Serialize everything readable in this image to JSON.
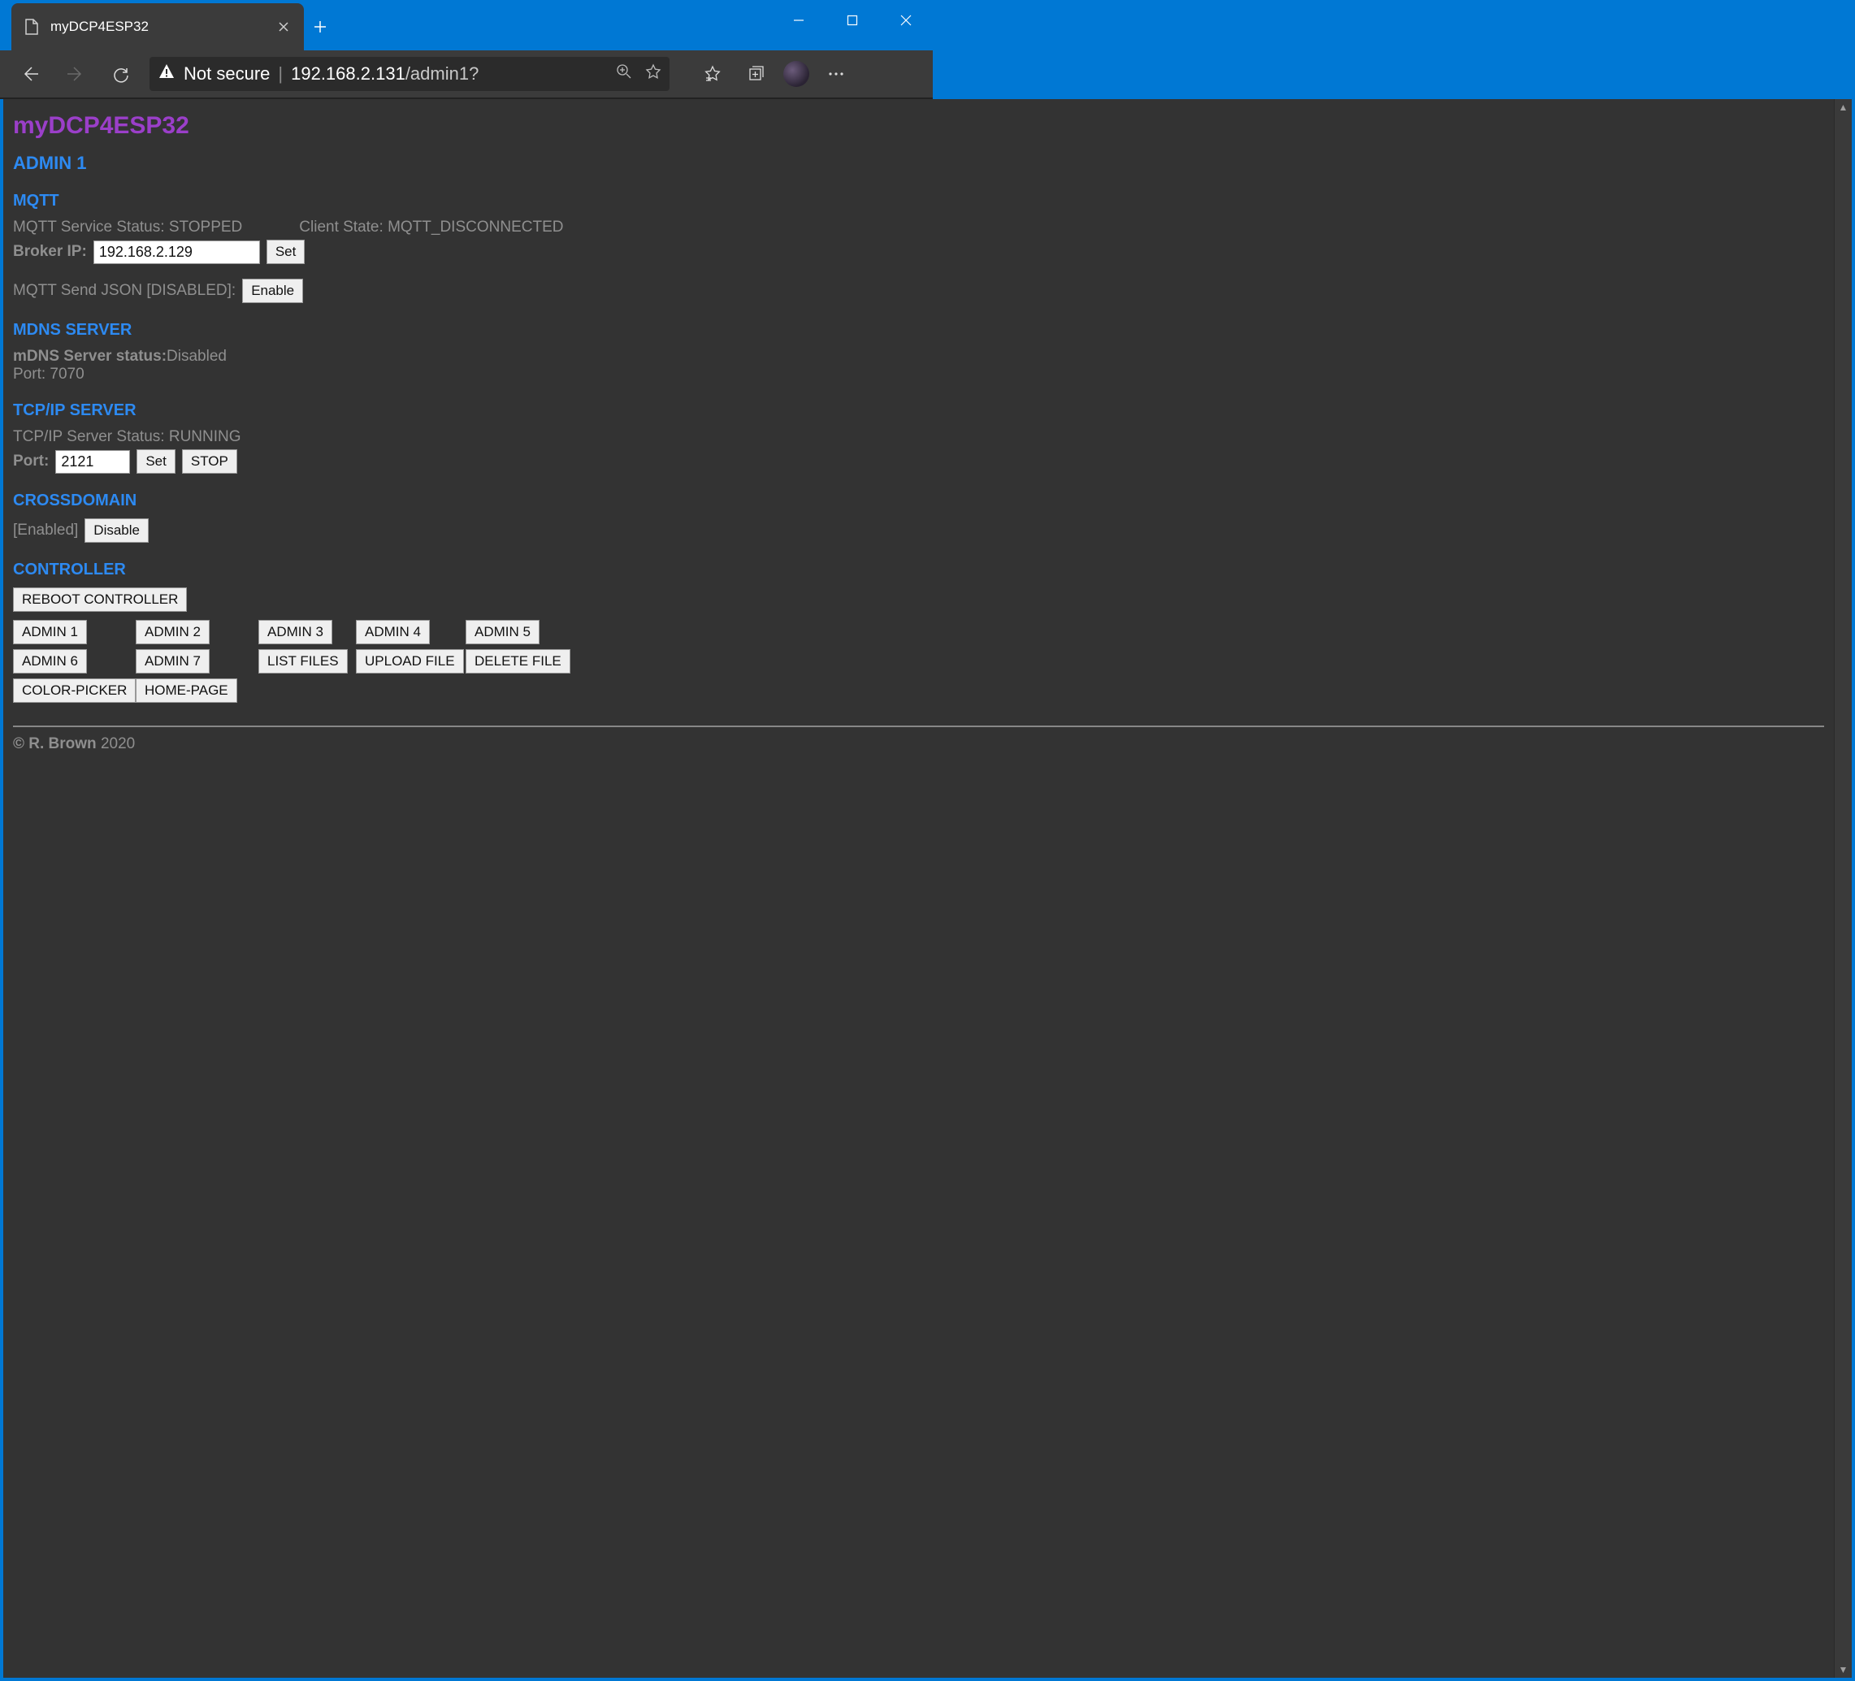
{
  "browser": {
    "tab_title": "myDCP4ESP32",
    "security_label": "Not secure",
    "url_host": "192.168.2.131",
    "url_path": "/admin1?"
  },
  "page": {
    "app_title": "myDCP4ESP32",
    "admin_heading": "ADMIN 1",
    "mqtt": {
      "heading": "MQTT",
      "service_status_label": "MQTT Service Status:",
      "service_status_value": "STOPPED",
      "client_state_label": "Client State:",
      "client_state_value": "MQTT_DISCONNECTED",
      "broker_ip_label": "Broker IP:",
      "broker_ip_value": "192.168.2.129",
      "set_label": "Set",
      "send_json_label": "MQTT Send JSON [DISABLED]:",
      "send_json_btn": "Enable"
    },
    "mdns": {
      "heading": "MDNS SERVER",
      "status_label": "mDNS Server status:",
      "status_value": "Disabled",
      "port_label": "Port:",
      "port_value": "7070"
    },
    "tcpip": {
      "heading": "TCP/IP SERVER",
      "status_label": "TCP/IP Server Status:",
      "status_value": "RUNNING",
      "port_label": "Port:",
      "port_value": "2121",
      "set_label": "Set",
      "stop_label": "STOP"
    },
    "crossdomain": {
      "heading": "CROSSDOMAIN",
      "state": "[Enabled]",
      "btn": "Disable"
    },
    "controller": {
      "heading": "CONTROLLER",
      "reboot": "REBOOT CONTROLLER"
    },
    "nav": {
      "row1": [
        "ADMIN 1",
        "ADMIN 2",
        "ADMIN 3",
        "ADMIN 4",
        "ADMIN 5"
      ],
      "row2": [
        "ADMIN 6",
        "ADMIN 7",
        "LIST FILES",
        "UPLOAD FILE",
        "DELETE FILE"
      ],
      "row3": [
        "COLOR-PICKER",
        "HOME-PAGE"
      ]
    },
    "footer": {
      "owner": "© R. Brown",
      "year": "2020"
    }
  }
}
